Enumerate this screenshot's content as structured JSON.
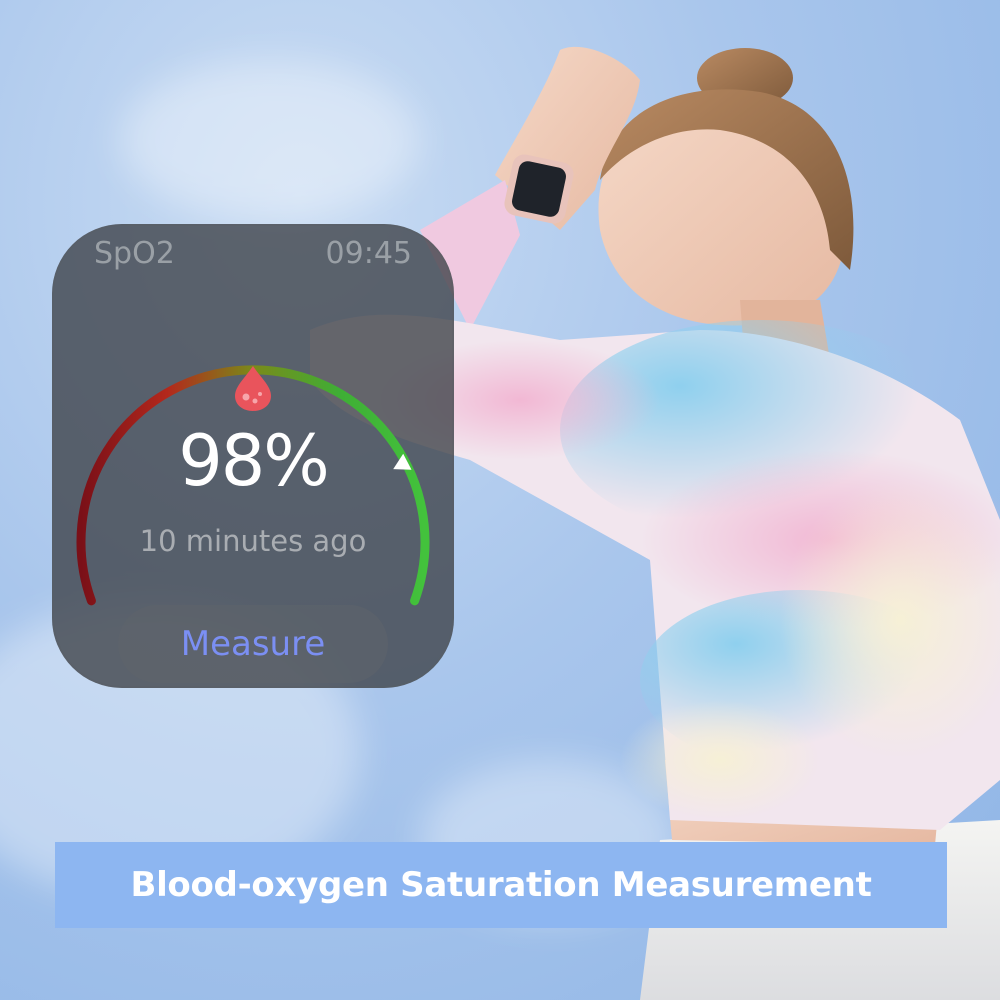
{
  "watch_face": {
    "metric_label": "SpO2",
    "clock": "09:45",
    "value": "98%",
    "value_level_percent": 98,
    "last_measured": "10 minutes ago",
    "measure_button": "Measure",
    "gauge_colors": [
      "#7a1018",
      "#c4391f",
      "#7a8a1a",
      "#3fae35",
      "#43c23c"
    ],
    "button_text_color": "#7b8ff3"
  },
  "banner": {
    "text": "Blood-oxygen Saturation Measurement",
    "background": "#8db6f1"
  }
}
